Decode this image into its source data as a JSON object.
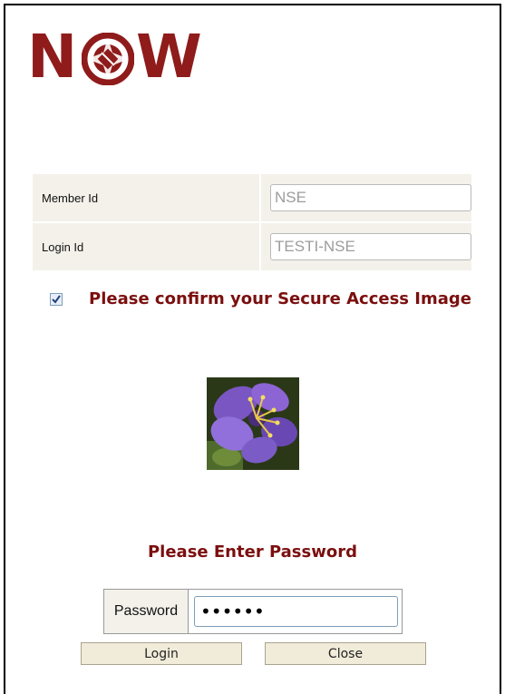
{
  "logo": {
    "text_left": "N",
    "text_right": "W",
    "brand_color": "#8f1b1b"
  },
  "credentials": {
    "member_label": "Member Id",
    "member_value": "NSE",
    "login_label": "Login Id",
    "login_value": "TESTI-NSE"
  },
  "confirm": {
    "checked": true,
    "text": "Please confirm your Secure Access Image"
  },
  "password": {
    "heading": "Please Enter Password",
    "label": "Password",
    "masked_value": "••••••"
  },
  "buttons": {
    "login": "Login",
    "close": "Close"
  },
  "icons": {
    "checkbox": "checkmark-icon",
    "secure_image": "flower-image"
  }
}
